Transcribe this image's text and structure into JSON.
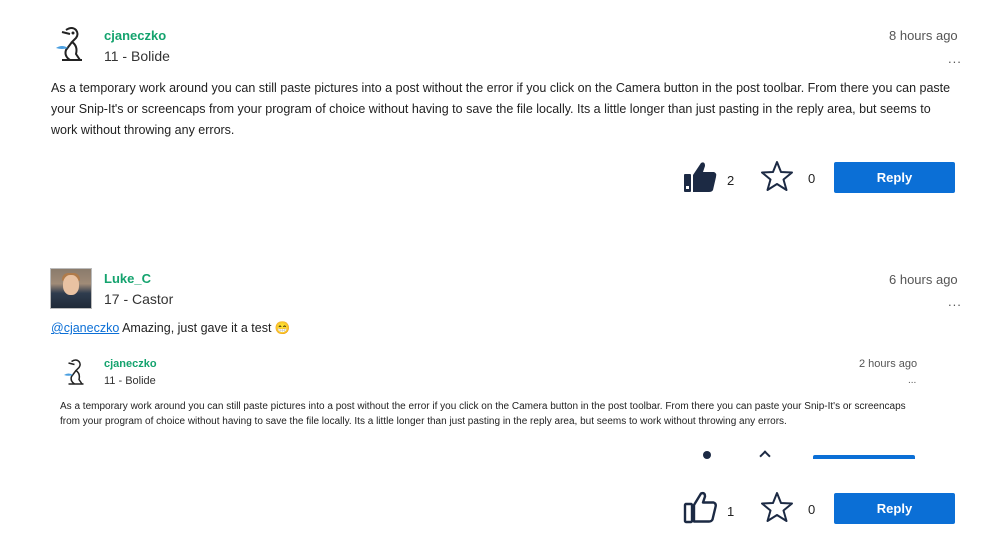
{
  "post1": {
    "author": "cjaneczko",
    "rank": "11 - Bolide",
    "time": "8 hours ago",
    "menu": "...",
    "body": "As a temporary work around you can still paste pictures into a post without the error if you click on the Camera button in the post toolbar. From there you can paste your Snip-It's or screencaps from your program of choice without having to save the file locally. Its a little longer than just pasting in the reply area, but seems to work without throwing any errors.",
    "likes": "2",
    "stars": "0",
    "reply_label": "Reply"
  },
  "post2": {
    "author": "Luke_C",
    "rank": "17 - Castor",
    "time": "6 hours ago",
    "menu": "...",
    "mention": "@cjaneczko",
    "body": " Amazing, just gave it a test ",
    "emoji": "😁",
    "likes": "1",
    "stars": "0",
    "reply_label": "Reply"
  },
  "quote": {
    "author": "cjaneczko",
    "rank": "11 - Bolide",
    "time": "2 hours ago",
    "menu": "...",
    "body": "As a temporary work around you can still paste pictures into a post without the error if you click on the Camera button in the post toolbar. From there you can paste your Snip-It's or screencaps from your program of choice without having to save the file locally. Its a little longer than just pasting in the reply area, but seems to work without throwing any errors."
  },
  "colors": {
    "author": "#14a36e",
    "reply_button": "#0b6fd6",
    "icon": "#1c2a44"
  },
  "icons": {
    "avatar_cjaneczko": "bird-sketch-avatar",
    "avatar_luke": "profile-photo",
    "like_filled": "thumbs-up-filled-icon",
    "like_outline": "thumbs-up-outline-icon",
    "star": "star-outline-icon"
  }
}
